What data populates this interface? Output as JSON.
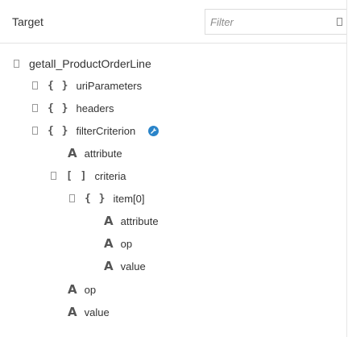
{
  "header": {
    "title": "Target",
    "filter_placeholder": "Filter"
  },
  "tree": {
    "root": "getall_ProductOrderLine",
    "uriParameters": "uriParameters",
    "headers": "headers",
    "filterCriterion": "filterCriterion",
    "fc_attribute": "attribute",
    "criteria": "criteria",
    "item0": "item[0]",
    "item_attribute": "attribute",
    "item_op": "op",
    "item_value": "value",
    "fc_op": "op",
    "fc_value": "value"
  },
  "type_glyphs": {
    "object": "{ }",
    "array": "[ ]",
    "string": "A"
  },
  "icons": {
    "wrench": "wrench-icon",
    "wrench_color": "#2a84c9"
  }
}
